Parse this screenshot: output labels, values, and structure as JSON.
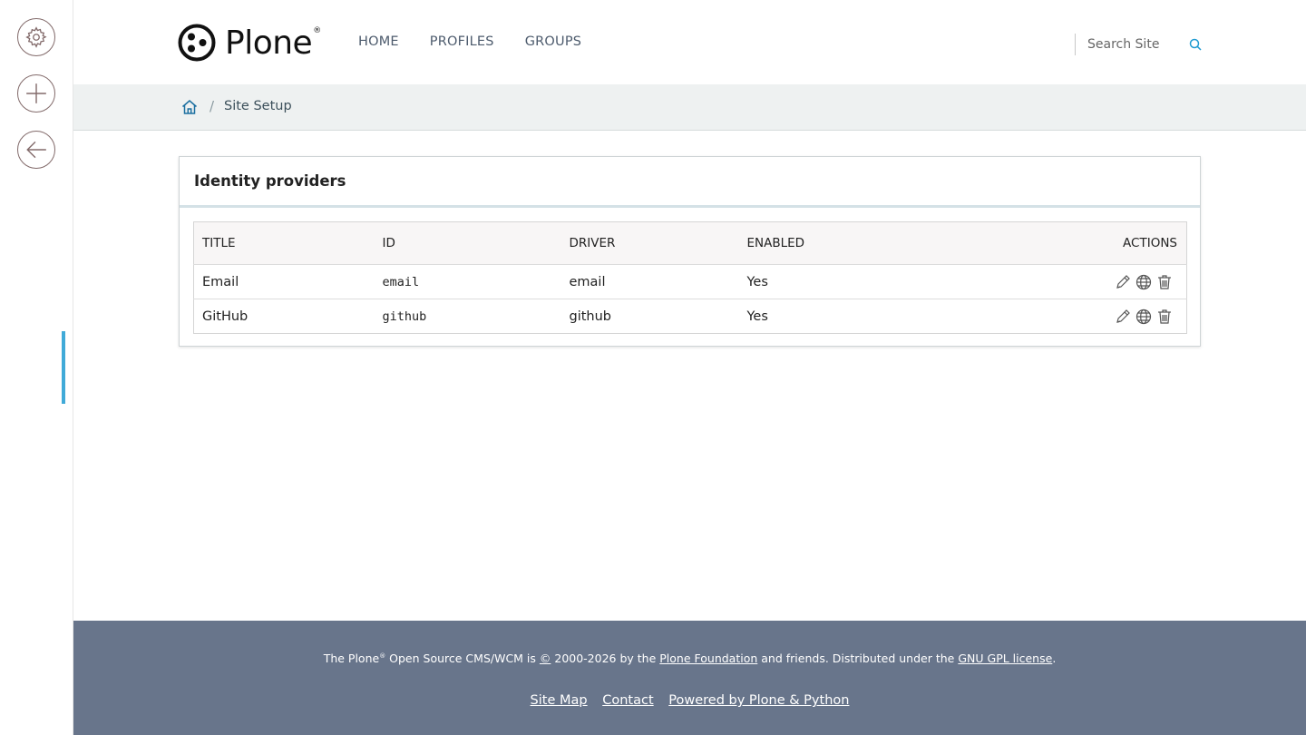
{
  "toolbar": {
    "settings_icon": "gear-icon",
    "add_icon": "plus-icon",
    "back_icon": "arrow-left-icon"
  },
  "header": {
    "logo_text": "Plone",
    "logo_reg": "®",
    "nav": [
      "HOME",
      "PROFILES",
      "GROUPS"
    ],
    "search_placeholder": "Search Site"
  },
  "breadcrumbs": {
    "home_icon": "home-icon",
    "separator": "/",
    "current": "Site Setup"
  },
  "card": {
    "title": "Identity providers",
    "columns": [
      "TITLE",
      "ID",
      "DRIVER",
      "ENABLED",
      "ACTIONS"
    ],
    "rows": [
      {
        "title": "Email",
        "id": "email",
        "driver": "email",
        "enabled": "Yes"
      },
      {
        "title": "GitHub",
        "id": "github",
        "driver": "github",
        "enabled": "Yes"
      }
    ],
    "action_icons": [
      "pencil-icon",
      "globe-icon",
      "trash-icon"
    ]
  },
  "footer": {
    "line_prefix": "The Plone",
    "line_reg": "®",
    "line_middle": " Open Source CMS/WCM is ",
    "copyright_symbol": "©",
    "line_years": " 2000-2026 by the ",
    "foundation_link": "Plone Foundation",
    "line_after_foundation": " and friends. Distributed under the ",
    "license_link": "GNU GPL license",
    "line_end": ".",
    "links": [
      "Site Map",
      "Contact",
      "Powered by Plone & Python"
    ]
  },
  "colors": {
    "accent": "#1f9bd1",
    "footer_bg": "#68758b",
    "breadcrumb_bg": "#eef1f1",
    "toolbar_icon": "#826a6a"
  }
}
